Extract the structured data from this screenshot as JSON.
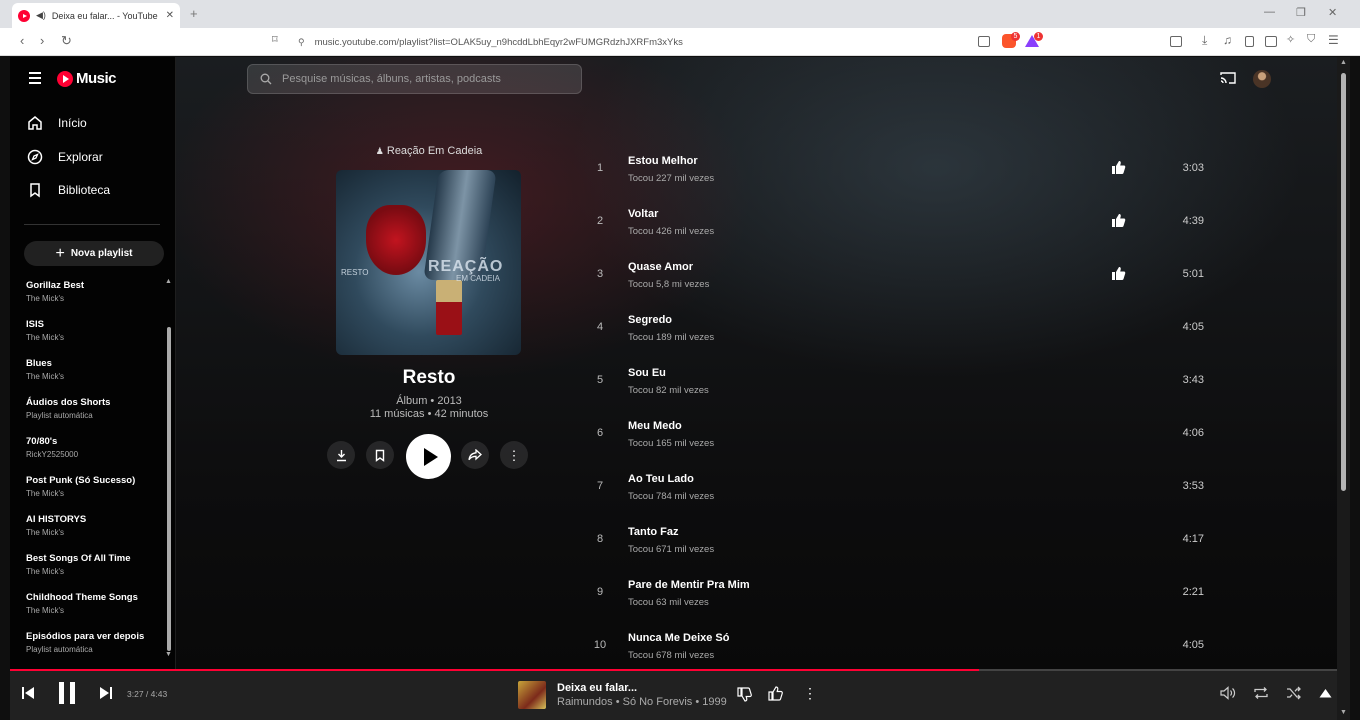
{
  "browser": {
    "tab_title": "Deixa eu falar... - YouTube Mu",
    "url": "music.youtube.com/playlist?list=OLAK5uy_n9hcddLbhEqyr2wFUMGRdzhJXRFm3xYks",
    "brave_badge": "5",
    "alert_badge": "1"
  },
  "app": {
    "logo_text": "Music",
    "search_placeholder": "Pesquise músicas, álbuns, artistas, podcasts"
  },
  "sidebar": {
    "nav": [
      {
        "label": "Início",
        "icon": "home-icon"
      },
      {
        "label": "Explorar",
        "icon": "explore-icon"
      },
      {
        "label": "Biblioteca",
        "icon": "library-icon"
      }
    ],
    "new_playlist_label": "Nova playlist",
    "playlists": [
      {
        "title": "Gorillaz Best",
        "subtitle": "The Mick's"
      },
      {
        "title": "ISIS",
        "subtitle": "The Mick's"
      },
      {
        "title": "Blues",
        "subtitle": "The Mick's"
      },
      {
        "title": "Áudios dos Shorts",
        "subtitle": "Playlist automática"
      },
      {
        "title": "70/80's",
        "subtitle": "RickY2525000"
      },
      {
        "title": "Post Punk (Só Sucesso)",
        "subtitle": "The Mick's"
      },
      {
        "title": "AI HISTORYS",
        "subtitle": "The Mick's"
      },
      {
        "title": "Best Songs Of All Time",
        "subtitle": "The Mick's"
      },
      {
        "title": "Childhood Theme Songs",
        "subtitle": "The Mick's"
      },
      {
        "title": "Episódios para ver depois",
        "subtitle": "Playlist automática"
      }
    ]
  },
  "album": {
    "artist": "Reação Em Cadeia",
    "cover_text_main": "REAÇÃO",
    "cover_text_sub": "EM CADEIA",
    "cover_text_left": "RESTO",
    "title": "Resto",
    "meta_line1": "Álbum • 2013",
    "meta_line2": "11 músicas • 42 minutos"
  },
  "tracks": [
    {
      "num": "1",
      "title": "Estou Melhor",
      "plays": "Tocou 227 mil vezes",
      "duration": "3:03",
      "liked": true
    },
    {
      "num": "2",
      "title": "Voltar",
      "plays": "Tocou 426 mil vezes",
      "duration": "4:39",
      "liked": true
    },
    {
      "num": "3",
      "title": "Quase Amor",
      "plays": "Tocou 5,8 mi vezes",
      "duration": "5:01",
      "liked": true
    },
    {
      "num": "4",
      "title": "Segredo",
      "plays": "Tocou 189 mil vezes",
      "duration": "4:05",
      "liked": false
    },
    {
      "num": "5",
      "title": "Sou Eu",
      "plays": "Tocou 82 mil vezes",
      "duration": "3:43",
      "liked": false
    },
    {
      "num": "6",
      "title": "Meu Medo",
      "plays": "Tocou 165 mil vezes",
      "duration": "4:06",
      "liked": false
    },
    {
      "num": "7",
      "title": "Ao Teu Lado",
      "plays": "Tocou 784 mil vezes",
      "duration": "3:53",
      "liked": false
    },
    {
      "num": "8",
      "title": "Tanto Faz",
      "plays": "Tocou 671 mil vezes",
      "duration": "4:17",
      "liked": false
    },
    {
      "num": "9",
      "title": "Pare de Mentir Pra Mim",
      "plays": "Tocou 63 mil vezes",
      "duration": "2:21",
      "liked": false
    },
    {
      "num": "10",
      "title": "Nunca Me Deixe Só",
      "plays": "Tocou 678 mil vezes",
      "duration": "4:05",
      "liked": false
    }
  ],
  "player": {
    "time": "3:27 / 4:43",
    "progress_fraction": 0.73,
    "song_title": "Deixa eu falar...",
    "song_artist": "Raimundos • Só No Forevis • 1999"
  },
  "colors": {
    "accent": "#ff0033",
    "background": "#0f0f0f",
    "player_bar": "#212121"
  }
}
